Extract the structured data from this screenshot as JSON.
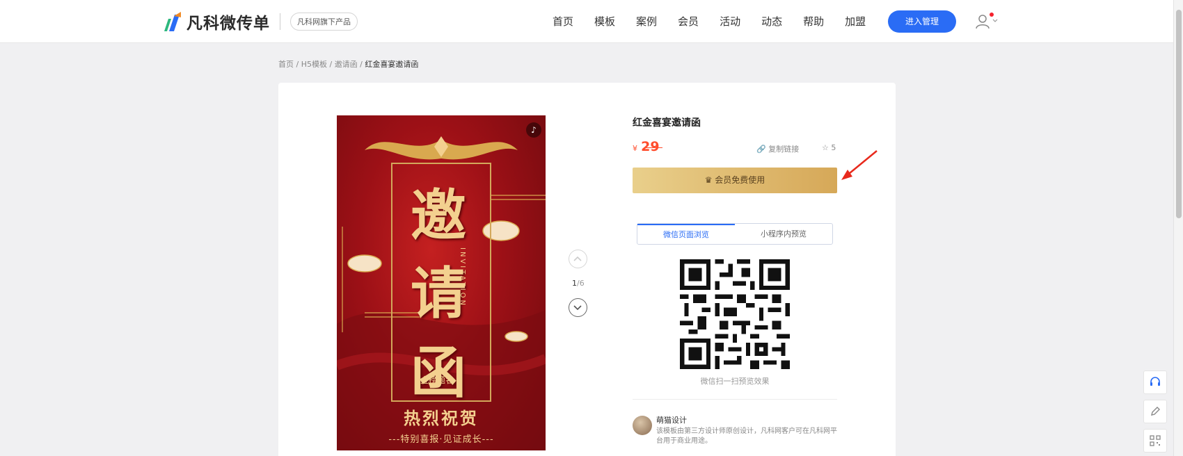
{
  "header": {
    "logo_text": "凡科微传单",
    "badge": "凡科网旗下产品",
    "nav": [
      "首页",
      "模板",
      "案例",
      "会员",
      "活动",
      "动态",
      "帮助",
      "加盟"
    ],
    "enter_button": "进入管理"
  },
  "breadcrumb": {
    "items": [
      "首页",
      "H5模板",
      "邀请函"
    ],
    "separator": " / ",
    "current": "红金喜宴邀请函"
  },
  "poster": {
    "char1": "邀",
    "char2": "请",
    "char3": "函",
    "invitation": "INVITATION",
    "tag": "金榜题名",
    "bottom_title": "热烈祝贺",
    "bottom_sub": "---特别喜报·见证成长---",
    "music_icon": "music-icon"
  },
  "pager": {
    "current": "1",
    "total": "6",
    "sep": "/"
  },
  "product": {
    "title": "红金喜宴邀请函",
    "currency": "¥",
    "price": "29",
    "copy_link": "复制链接",
    "favorites": "5",
    "vip_button": "会员免费使用"
  },
  "preview": {
    "tabs": [
      "微信页面浏览",
      "小程序内预览"
    ],
    "active_tab": 0,
    "qr_caption": "微信扫一扫预览效果"
  },
  "designer": {
    "name": "萌猫设计",
    "description": "该模板由第三方设计师原创设计，凡科网客户可在凡科网平台用于商业用途。"
  },
  "colors": {
    "primary": "#2a6cf5",
    "price": "#ff4d2d",
    "vip_gold": "#d6a858",
    "poster_red": "#9c1016",
    "poster_gold": "#f3d08f"
  },
  "side_tools": [
    "headset-icon",
    "edit-icon",
    "qrcode-icon"
  ]
}
